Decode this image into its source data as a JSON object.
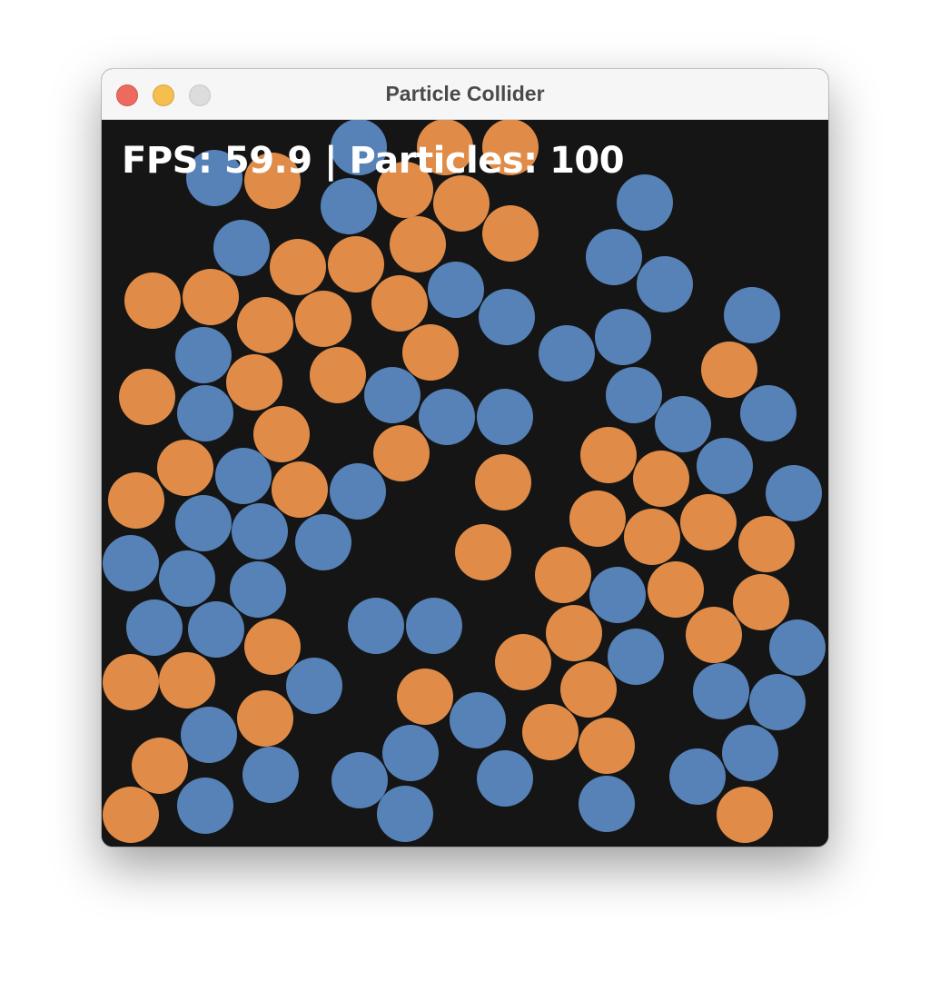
{
  "window": {
    "title": "Particle Collider"
  },
  "hud": {
    "text": "FPS: 59.9 | Particles: 100"
  },
  "colors": {
    "orange": "#e08c48",
    "blue": "#5682b8",
    "background": "#151515"
  }
}
